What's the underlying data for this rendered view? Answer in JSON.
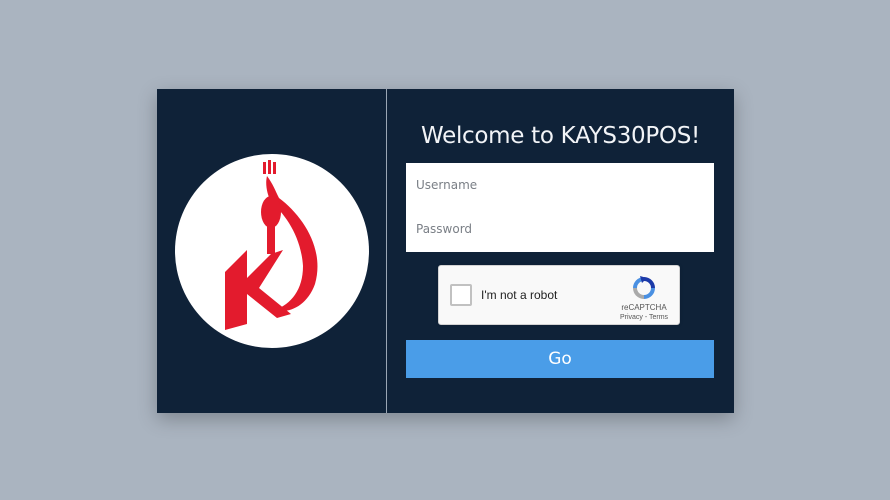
{
  "login": {
    "title": "Welcome to KAYS30POS!",
    "username_placeholder": "Username",
    "password_placeholder": "Password",
    "submit_label": "Go"
  },
  "captcha": {
    "label": "I'm not a robot",
    "brand": "reCAPTCHA",
    "privacy": "Privacy",
    "separator": " - ",
    "terms": "Terms"
  },
  "colors": {
    "page_background": "#aab4c0",
    "card_background": "#0f2238",
    "button": "#4a9de8",
    "logo_red": "#e31b2d"
  },
  "icons": {
    "logo": "kays30-logo-icon",
    "captcha": "recaptcha-icon"
  }
}
